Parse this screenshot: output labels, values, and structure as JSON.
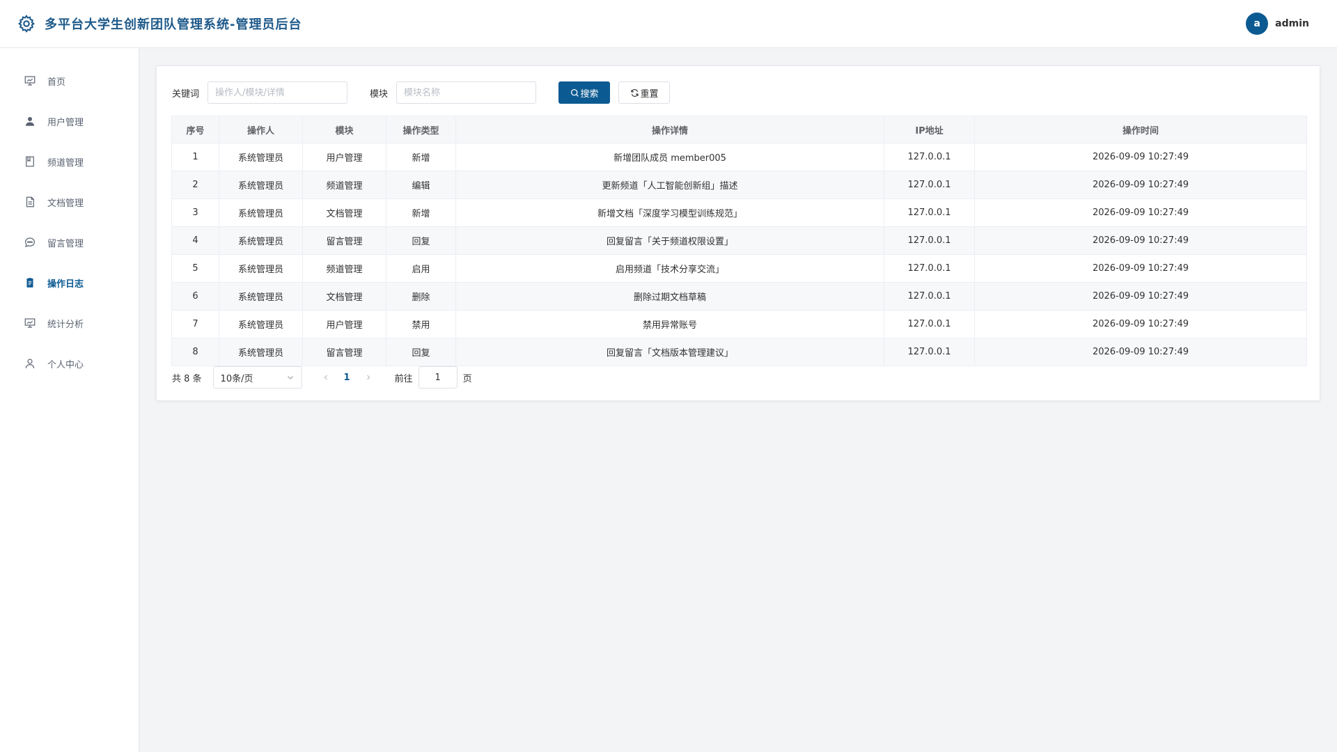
{
  "header": {
    "title": "多平台大学生创新团队管理系统-管理员后台",
    "avatar_letter": "a",
    "username": "admin",
    "accent": "#0c5a92"
  },
  "sidebar": {
    "items": [
      {
        "label": "首页",
        "icon": "dashboard-icon",
        "active": false
      },
      {
        "label": "用户管理",
        "icon": "user-icon",
        "active": false
      },
      {
        "label": "频道管理",
        "icon": "channel-icon",
        "active": false
      },
      {
        "label": "文档管理",
        "icon": "document-icon",
        "active": false
      },
      {
        "label": "留言管理",
        "icon": "message-icon",
        "active": false
      },
      {
        "label": "操作日志",
        "icon": "log-icon",
        "active": true
      },
      {
        "label": "统计分析",
        "icon": "chart-icon",
        "active": false
      },
      {
        "label": "个人中心",
        "icon": "profile-icon",
        "active": false
      }
    ]
  },
  "filter": {
    "keyword_label": "关键词",
    "keyword_placeholder": "操作人/模块/详情",
    "keyword_value": "",
    "module_label": "模块",
    "module_placeholder": "模块名称",
    "module_value": "",
    "search_label": "搜索",
    "reset_label": "重置"
  },
  "table": {
    "columns": [
      "序号",
      "操作人",
      "模块",
      "操作类型",
      "操作详情",
      "IP地址",
      "操作时间"
    ],
    "rows": [
      [
        "1",
        "系统管理员",
        "用户管理",
        "新增",
        "新增团队成员 member005",
        "127.0.0.1",
        "2026-09-09 10:27:49"
      ],
      [
        "2",
        "系统管理员",
        "频道管理",
        "编辑",
        "更新频道「人工智能创新组」描述",
        "127.0.0.1",
        "2026-09-09 10:27:49"
      ],
      [
        "3",
        "系统管理员",
        "文档管理",
        "新增",
        "新增文档「深度学习模型训练规范」",
        "127.0.0.1",
        "2026-09-09 10:27:49"
      ],
      [
        "4",
        "系统管理员",
        "留言管理",
        "回复",
        "回复留言「关于频道权限设置」",
        "127.0.0.1",
        "2026-09-09 10:27:49"
      ],
      [
        "5",
        "系统管理员",
        "频道管理",
        "启用",
        "启用频道「技术分享交流」",
        "127.0.0.1",
        "2026-09-09 10:27:49"
      ],
      [
        "6",
        "系统管理员",
        "文档管理",
        "删除",
        "删除过期文档草稿",
        "127.0.0.1",
        "2026-09-09 10:27:49"
      ],
      [
        "7",
        "系统管理员",
        "用户管理",
        "禁用",
        "禁用异常账号",
        "127.0.0.1",
        "2026-09-09 10:27:49"
      ],
      [
        "8",
        "系统管理员",
        "留言管理",
        "回复",
        "回复留言「文档版本管理建议」",
        "127.0.0.1",
        "2026-09-09 10:27:49"
      ]
    ]
  },
  "pager": {
    "total": "共 8 条",
    "page_size": "10条/页",
    "current_page": "1",
    "goto_label": "前往",
    "goto_value": "1",
    "page_unit": "页"
  }
}
